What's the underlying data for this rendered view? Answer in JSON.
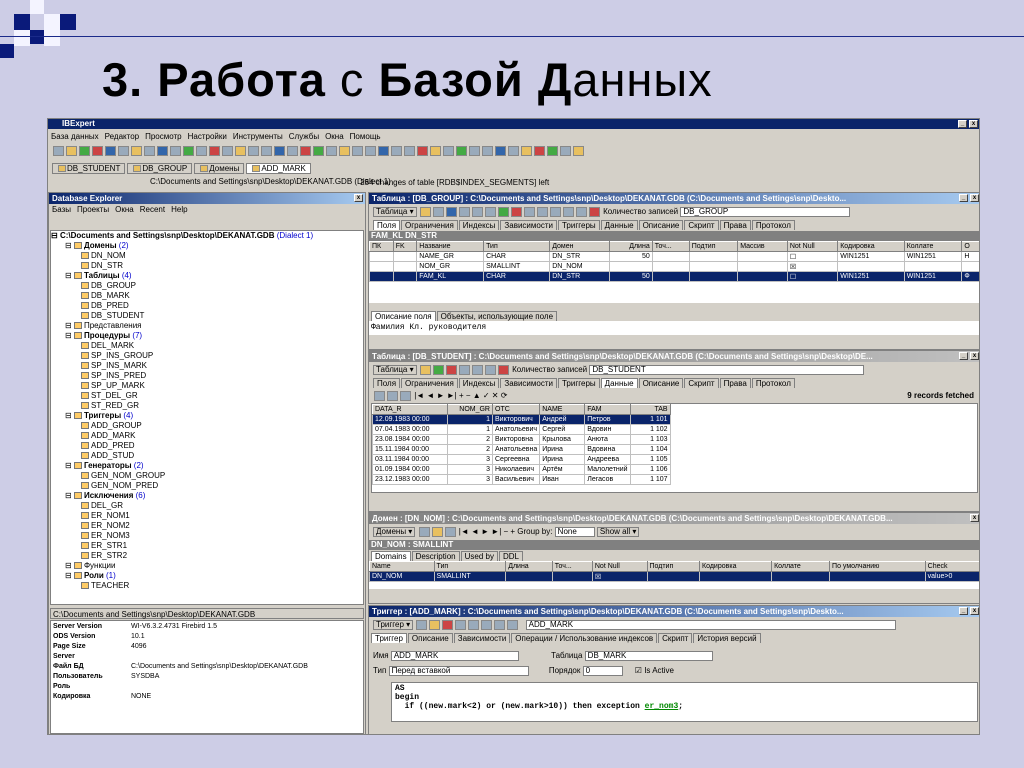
{
  "slide": {
    "title_bold1": "3. Работа ",
    "title_light": "с ",
    "title_bold2": "Базой Д",
    "title_light2": "анных"
  },
  "app": {
    "title": "IBExpert",
    "menu": [
      "База данных",
      "Редактор",
      "Просмотр",
      "Настройки",
      "Инструменты",
      "Службы",
      "Окна",
      "Помощь"
    ],
    "db_tabs": [
      "DB_STUDENT",
      "DB_GROUP",
      "Домены",
      "ADD_MARK"
    ],
    "status_path": "C:\\Documents and Settings\\snp\\Desktop\\DEKANAT.GDB (Dialect 1)",
    "status_msg": "254 changes of table [RDB$INDEX_SEGMENTS] left"
  },
  "explorer": {
    "title": "Database Explorer",
    "menu": [
      "Базы",
      "Проекты",
      "Окна",
      "Recent",
      "Help"
    ],
    "root": "C:\\Documents and Settings\\snp\\Desktop\\DEKANAT.GDB",
    "root_dialect": "(Dialect 1)",
    "tree": [
      {
        "level": 1,
        "label": "Домены",
        "count": "(2)",
        "bold": true
      },
      {
        "level": 2,
        "label": "DN_NOM"
      },
      {
        "level": 2,
        "label": "DN_STR"
      },
      {
        "level": 1,
        "label": "Таблицы",
        "count": "(4)",
        "bold": true
      },
      {
        "level": 2,
        "label": "DB_GROUP"
      },
      {
        "level": 2,
        "label": "DB_MARK"
      },
      {
        "level": 2,
        "label": "DB_PRED"
      },
      {
        "level": 2,
        "label": "DB_STUDENT"
      },
      {
        "level": 1,
        "label": "Представления"
      },
      {
        "level": 1,
        "label": "Процедуры",
        "count": "(7)",
        "bold": true
      },
      {
        "level": 2,
        "label": "DEL_MARK"
      },
      {
        "level": 2,
        "label": "SP_INS_GROUP"
      },
      {
        "level": 2,
        "label": "SP_INS_MARK"
      },
      {
        "level": 2,
        "label": "SP_INS_PRED"
      },
      {
        "level": 2,
        "label": "SP_UP_MARK"
      },
      {
        "level": 2,
        "label": "ST_DEL_GR"
      },
      {
        "level": 2,
        "label": "ST_RED_GR"
      },
      {
        "level": 1,
        "label": "Триггеры",
        "count": "(4)",
        "bold": true
      },
      {
        "level": 2,
        "label": "ADD_GROUP"
      },
      {
        "level": 2,
        "label": "ADD_MARK"
      },
      {
        "level": 2,
        "label": "ADD_PRED"
      },
      {
        "level": 2,
        "label": "ADD_STUD"
      },
      {
        "level": 1,
        "label": "Генераторы",
        "count": "(2)",
        "bold": true
      },
      {
        "level": 2,
        "label": "GEN_NOM_GROUP"
      },
      {
        "level": 2,
        "label": "GEN_NOM_PRED"
      },
      {
        "level": 1,
        "label": "Исключения",
        "count": "(6)",
        "bold": true
      },
      {
        "level": 2,
        "label": "DEL_GR"
      },
      {
        "level": 2,
        "label": "ER_NOM1"
      },
      {
        "level": 2,
        "label": "ER_NOM2"
      },
      {
        "level": 2,
        "label": "ER_NOM3"
      },
      {
        "level": 2,
        "label": "ER_STR1"
      },
      {
        "level": 2,
        "label": "ER_STR2"
      },
      {
        "level": 1,
        "label": "Функции"
      },
      {
        "level": 1,
        "label": "Роли",
        "count": "(1)",
        "bold": true
      },
      {
        "level": 2,
        "label": "TEACHER"
      }
    ],
    "info_path": "C:\\Documents and Settings\\snp\\Desktop\\DEKANAT.GDB",
    "info": [
      [
        "Server Version",
        "WI-V6.3.2.4731 Firebird 1.5"
      ],
      [
        "ODS Version",
        "10.1"
      ],
      [
        "Page Size",
        "4096"
      ],
      [
        "Server",
        ""
      ],
      [
        "Файл БД",
        "C:\\Documents and Settings\\snp\\Desktop\\DEKANAT.GDB"
      ],
      [
        "Пользователь",
        "SYSDBA"
      ],
      [
        "Роль",
        ""
      ],
      [
        "Кодировка",
        "NONE"
      ]
    ]
  },
  "group": {
    "title": "Таблица : [DB_GROUP] : C:\\Documents and Settings\\snp\\Desktop\\DEKANAT.GDB (C:\\Documents and Settings\\snp\\Deskto...",
    "table_btn": "Таблица",
    "records_label": "Количество записей",
    "table_name": "DB_GROUP",
    "tabs": [
      "Поля",
      "Ограничения",
      "Индексы",
      "Зависимости",
      "Триггеры",
      "Данные",
      "Описание",
      "Скрипт",
      "Права",
      "Протокол"
    ],
    "header": "FAM_KL DN_STR",
    "columns": [
      "ПК",
      "FK",
      "Название",
      "Тип",
      "Домен",
      "Длина",
      "Точ...",
      "Подтип",
      "Массив",
      "Not Null",
      "Кодировка",
      "Коллате",
      "О"
    ],
    "rows": [
      [
        "",
        "",
        "NAME_GR",
        "CHAR",
        "DN_STR",
        "50",
        "",
        "",
        "",
        "☐",
        "WIN1251",
        "WIN1251",
        "Н"
      ],
      [
        "",
        "",
        "NOM_GR",
        "SMALLINT",
        "DN_NOM",
        "",
        "",
        "",
        "",
        "☒",
        "",
        "",
        ""
      ],
      [
        "",
        "",
        "FAM_KL",
        "CHAR",
        "DN_STR",
        "50",
        "",
        "",
        "",
        "☐",
        "WIN1251",
        "WIN1251",
        "Ф"
      ]
    ],
    "desc_tabs": [
      "Описание поля",
      "Объекты, использующие поле"
    ],
    "desc": "Фамилия Кл. руководителя"
  },
  "student": {
    "title": "Таблица : [DB_STUDENT] : C:\\Documents and Settings\\snp\\Desktop\\DEKANAT.GDB (C:\\Documents and Settings\\snp\\Desktop\\DE...",
    "table_btn": "Таблица",
    "records_label": "Количество записей",
    "table_name": "DB_STUDENT",
    "tabs": [
      "Поля",
      "Ограничения",
      "Индексы",
      "Зависимости",
      "Триггеры",
      "Данные",
      "Описание",
      "Скрипт",
      "Права",
      "Протокол"
    ],
    "fetched": "9 records fetched",
    "columns": [
      "DATA_R",
      "NOM_GR",
      "OTC",
      "NAME",
      "FAM",
      "TAB"
    ],
    "rows": [
      [
        "12.09.1983 00:00",
        "1",
        "Викторович",
        "Андрей",
        "Петров",
        "1 101"
      ],
      [
        "07.04.1983 00:00",
        "1",
        "Анатольевич",
        "Сергей",
        "Вдовин",
        "1 102"
      ],
      [
        "23.08.1984 00:00",
        "2",
        "Викторовна",
        "Крылова",
        "Анюта",
        "1 103"
      ],
      [
        "15.11.1984 00:00",
        "2",
        "Анатольевна",
        "Ирина",
        "Вдовина",
        "1 104"
      ],
      [
        "03.11.1984 00:00",
        "3",
        "Сергеевна",
        "Ирина",
        "Андреева",
        "1 105"
      ],
      [
        "01.09.1984 00:00",
        "3",
        "Николаевич",
        "Артём",
        "Малолетний",
        "1 106"
      ],
      [
        "23.12.1983 00:00",
        "3",
        "Васильевич",
        "Иван",
        "Легасов",
        "1 107"
      ]
    ]
  },
  "domain": {
    "title": "Домен : [DN_NOM] : C:\\Documents and Settings\\snp\\Desktop\\DEKANAT.GDB (C:\\Documents and Settings\\snp\\Desktop\\DEKANAT.GDB...",
    "domain_btn": "Домены",
    "group_by": "Group by:",
    "group_val": "None",
    "show_all": "Show all",
    "header": "DN_NOM : SMALLINT",
    "tabs": [
      "Domains",
      "Description",
      "Used by",
      "DDL"
    ],
    "columns": [
      "Name",
      "Тип",
      "Длина",
      "Точ...",
      "Not Null",
      "Подтип",
      "Кодировка",
      "Коллате",
      "По умолчанию",
      "Check"
    ],
    "row": [
      "DN_NOM",
      "SMALLINT",
      "",
      "",
      "☒",
      "",
      "",
      "",
      "",
      "value>0"
    ]
  },
  "trigger": {
    "title": "Триггер : [ADD_MARK] : C:\\Documents and Settings\\snp\\Desktop\\DEKANAT.GDB (C:\\Documents and Settings\\snp\\Deskto...",
    "trigger_btn": "Триггер",
    "name_sel": "ADD_MARK",
    "tabs": [
      "Триггер",
      "Описание",
      "Зависимости",
      "Операции / Использование индексов",
      "Скрипт",
      "История версий"
    ],
    "name_label": "Имя",
    "name_val": "ADD_MARK",
    "table_label": "Таблица",
    "table_val": "DB_MARK",
    "type_label": "Тип",
    "type_val": "Перед вставкой",
    "order_label": "Порядок",
    "order_val": "0",
    "active_label": "Is Active",
    "code": [
      "AS",
      "begin",
      "  if ((new.mark<2) or (new.mark>10)) then exception ",
      "er_nom3",
      ";"
    ]
  }
}
